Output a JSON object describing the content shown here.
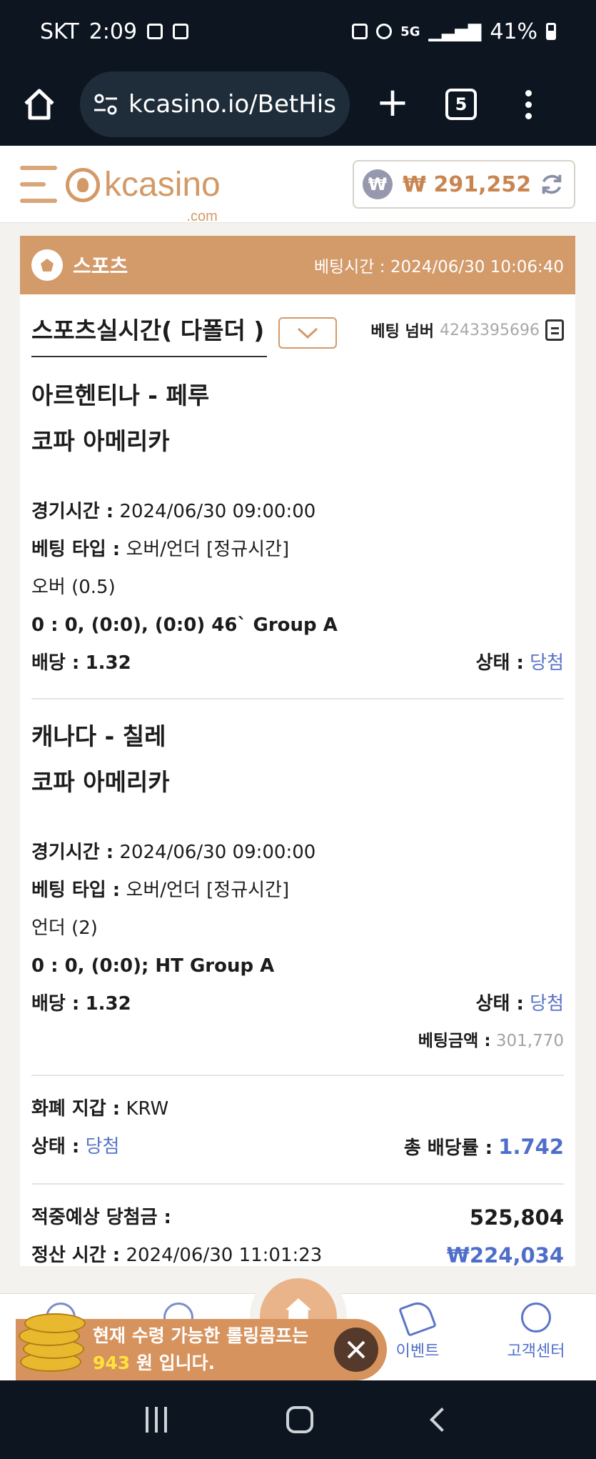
{
  "status_bar": {
    "carrier": "SKT",
    "time": "2:09",
    "battery": "41%",
    "network": "5G"
  },
  "browser": {
    "url": "kcasino.io/BetHis",
    "tab_count": "5"
  },
  "header": {
    "logo_text": "kcasino",
    "logo_sub": ".com",
    "balance": "₩ 291,252",
    "currency_symbol": "₩"
  },
  "card": {
    "sport": "스포츠",
    "bet_time_label": "베팅시간 : 2024/06/30 10:06:40",
    "bet_type": "스포츠실시간( 다폴더 )",
    "bet_number_label": "베팅 넘버",
    "bet_number": "4243395696",
    "matches": [
      {
        "name": "아르헨티나 - 페루",
        "league": "코파 아메리카",
        "game_time_label": "경기시간 :",
        "game_time": "2024/06/30 09:00:00",
        "bet_kind_label": "베팅 타입 :",
        "bet_kind": "오버/언더 [정규시간]",
        "pick": "오버 (0.5)",
        "score": "0 : 0, (0:0), (0:0) 46` Group A",
        "odds_label": "배당 :",
        "odds": "1.32",
        "status_label": "상태 :",
        "status": "당첨"
      },
      {
        "name": "캐나다 - 칠레",
        "league": "코파 아메리카",
        "game_time_label": "경기시간 :",
        "game_time": "2024/06/30 09:00:00",
        "bet_kind_label": "베팅 타입 :",
        "bet_kind": "오버/언더 [정규시간]",
        "pick": "언더 (2)",
        "score": "0 : 0, (0:0); HT Group A",
        "odds_label": "배당 :",
        "odds": "1.32",
        "status_label": "상태 :",
        "status": "당첨"
      }
    ],
    "bet_amount_label": "베팅금액 :",
    "bet_amount": "301,770",
    "currency_label": "화폐 지갑 :",
    "currency": "KRW",
    "overall_status_label": "상태 :",
    "overall_status": "당첨",
    "total_odds_label": "총 배당률 :",
    "total_odds": "1.742",
    "expected_win_label": "적중예상 당첨금 :",
    "expected_win": "525,804",
    "settle_time_label": "정산 시간 :",
    "settle_time": "2024/06/30 11:01:23",
    "settle_amount": "₩224,034"
  },
  "bottom_nav": {
    "event": "이벤트",
    "support": "고객센터"
  },
  "toast": {
    "line1": "현재 수령 가능한 롤링콤프는",
    "amount": "943",
    "line2_suffix": "원 입니다."
  }
}
